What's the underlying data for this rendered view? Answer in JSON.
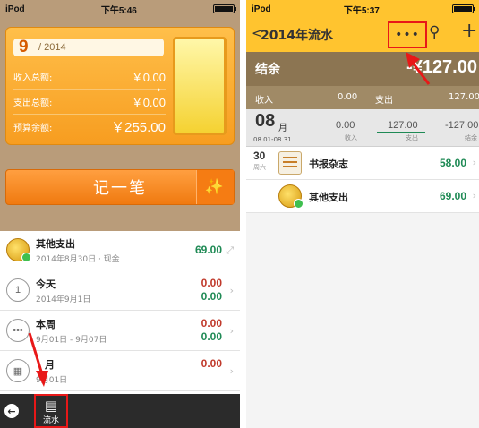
{
  "left": {
    "status": {
      "carrier": "iPod",
      "time": "下午5:46"
    },
    "summary": {
      "month": "9",
      "year": "/ 2014",
      "income_label": "收入总额:",
      "income_value": "￥0.00",
      "expense_label": "支出总额:",
      "expense_value": "￥0.00",
      "budget_label": "预算余额:",
      "budget_value": "￥255.00"
    },
    "record_button": "记一笔",
    "list": [
      {
        "title": "其他支出",
        "sub": "2014年8月30日 · 现金",
        "amount": "69.00"
      },
      {
        "title": "今天",
        "sub": "2014年9月1日",
        "amount_red": "0.00",
        "amount_green": "0.00",
        "icon_text": "1"
      },
      {
        "title": "本周",
        "sub": "9月01日 - 9月07日",
        "amount_red": "0.00",
        "amount_green": "0.00",
        "icon_text": "•••"
      },
      {
        "title": "月",
        "sub": "9月01日",
        "amount_red": "0.00"
      }
    ],
    "tabbar": {
      "flow_label": "流水"
    }
  },
  "right": {
    "status": {
      "carrier": "iPod",
      "time": "下午5:37"
    },
    "header": {
      "back": "<",
      "title": "2014年流水",
      "more": "•••",
      "add": "+"
    },
    "balance": {
      "label": "结余",
      "value": "-¥127.00"
    },
    "inout": {
      "income_label": "收入",
      "income_value": "0.00",
      "expense_label": "支出",
      "expense_value": "127.00"
    },
    "period": {
      "month": "08",
      "unit": "月",
      "range": "08.01-08.31",
      "income": "0.00",
      "income_cap": "收入",
      "expense": "127.00",
      "expense_cap": "支出",
      "balance": "-127.00",
      "balance_cap": "结余"
    },
    "entries": [
      {
        "day": "30",
        "weekday": "周六",
        "name": "书报杂志",
        "amount": "58.00"
      },
      {
        "name": "其他支出",
        "amount": "69.00"
      }
    ]
  },
  "colors": {
    "accent": "#ffc42f",
    "orange": "#f79d20",
    "green": "#1f8a55",
    "red": "#c0392b",
    "highlight": "#e81818"
  }
}
